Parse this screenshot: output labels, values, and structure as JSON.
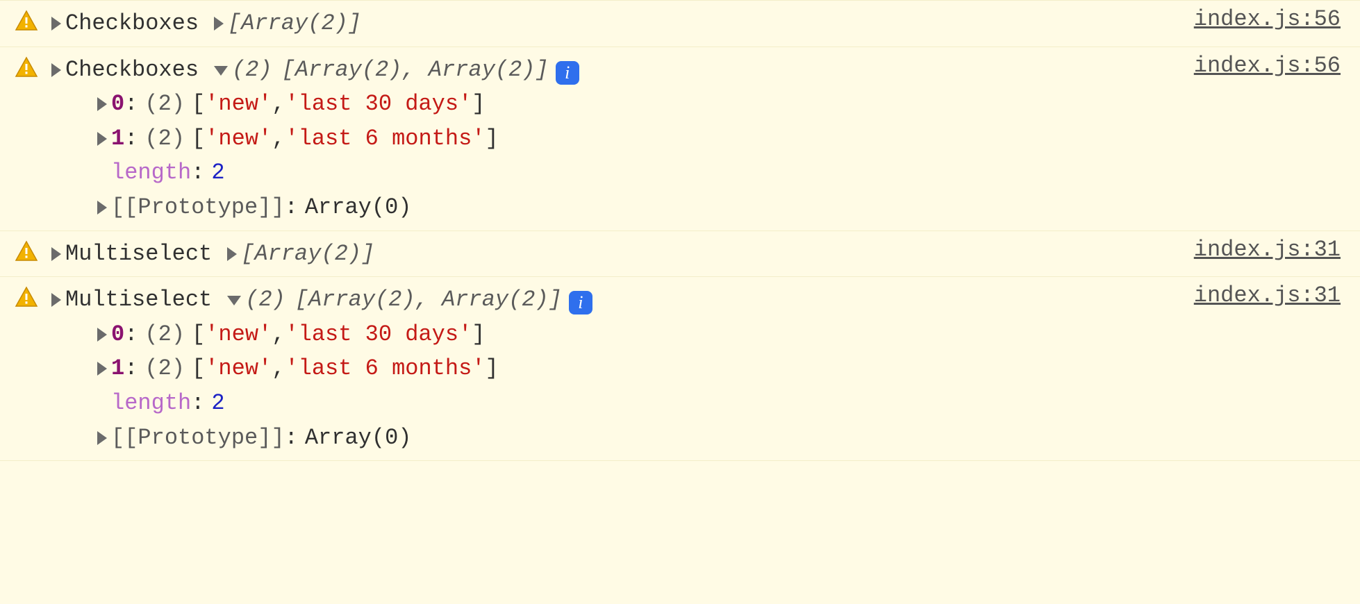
{
  "rows": [
    {
      "label": "Checkboxes",
      "source": "index.js:56",
      "expanded": false,
      "summary_collapsed": "[Array(2)]"
    },
    {
      "label": "Checkboxes",
      "source": "index.js:56",
      "expanded": true,
      "summary_count": "(2)",
      "summary_body": "[Array(2), Array(2)]",
      "items": [
        {
          "index": "0",
          "count": "(2)",
          "v0": "'new'",
          "v1": "'last 30 days'"
        },
        {
          "index": "1",
          "count": "(2)",
          "v0": "'new'",
          "v1": "'last 6 months'"
        }
      ],
      "length_label": "length",
      "length_value": "2",
      "proto_label": "[[Prototype]]",
      "proto_value": "Array(0)"
    },
    {
      "label": "Multiselect",
      "source": "index.js:31",
      "expanded": false,
      "summary_collapsed": "[Array(2)]"
    },
    {
      "label": "Multiselect",
      "source": "index.js:31",
      "expanded": true,
      "summary_count": "(2)",
      "summary_body": "[Array(2), Array(2)]",
      "items": [
        {
          "index": "0",
          "count": "(2)",
          "v0": "'new'",
          "v1": "'last 30 days'"
        },
        {
          "index": "1",
          "count": "(2)",
          "v0": "'new'",
          "v1": "'last 6 months'"
        }
      ],
      "length_label": "length",
      "length_value": "2",
      "proto_label": "[[Prototype]]",
      "proto_value": "Array(0)"
    }
  ],
  "info_badge_text": "i"
}
